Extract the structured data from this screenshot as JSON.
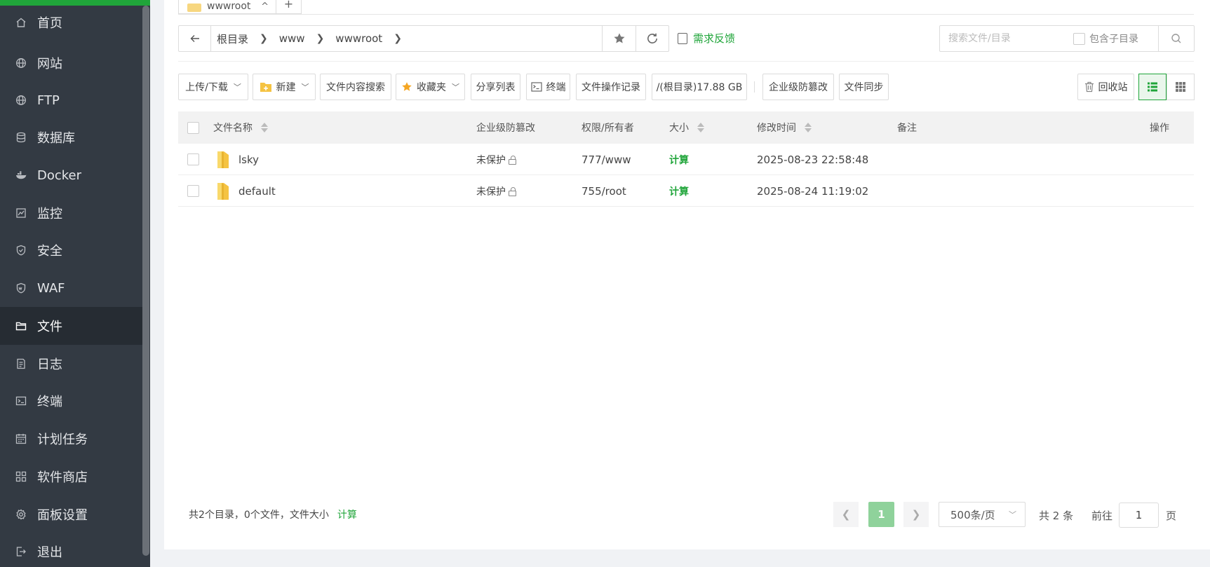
{
  "sidebar": {
    "items": [
      {
        "label": "首页",
        "icon": "home-icon"
      },
      {
        "label": "网站",
        "icon": "globe-icon"
      },
      {
        "label": "FTP",
        "icon": "ftp-globe-icon"
      },
      {
        "label": "数据库",
        "icon": "database-icon"
      },
      {
        "label": "Docker",
        "icon": "docker-icon"
      },
      {
        "label": "监控",
        "icon": "monitor-icon"
      },
      {
        "label": "安全",
        "icon": "shield-icon"
      },
      {
        "label": "WAF",
        "icon": "waf-shield-icon"
      },
      {
        "label": "文件",
        "icon": "folder-icon",
        "active": true
      },
      {
        "label": "日志",
        "icon": "log-icon"
      },
      {
        "label": "终端",
        "icon": "terminal-icon"
      },
      {
        "label": "计划任务",
        "icon": "calendar-icon"
      },
      {
        "label": "软件商店",
        "icon": "apps-icon"
      },
      {
        "label": "面板设置",
        "icon": "gear-icon"
      },
      {
        "label": "退出",
        "icon": "logout-icon"
      }
    ]
  },
  "tabs": {
    "active_label": "wwwroot",
    "close_glyph": "^",
    "add_glyph": "+"
  },
  "path": {
    "crumbs": [
      "根目录",
      "www",
      "wwwroot"
    ],
    "feedback_label": "需求反馈"
  },
  "search": {
    "placeholder": "搜索文件/目录",
    "subdir_label": "包含子目录"
  },
  "toolbar": {
    "upload_download": "上传/下载",
    "new": "新建",
    "content_search": "文件内容搜索",
    "favorites": "收藏夹",
    "share_list": "分享列表",
    "terminal": "终端",
    "op_log": "文件操作记录",
    "disk": "/(根目录)17.88 GB",
    "tamper": "企业级防篡改",
    "sync": "文件同步",
    "recycle": "回收站"
  },
  "table": {
    "headers": {
      "name": "文件名称",
      "tamper": "企业级防篡改",
      "perm": "权限/所有者",
      "size": "大小",
      "mtime": "修改时间",
      "remark": "备注",
      "ops": "操作"
    },
    "rows": [
      {
        "name": "lsky",
        "tamper": "未保护",
        "perm": "777/www",
        "size": "计算",
        "mtime": "2025-08-23 22:58:48",
        "remark": ""
      },
      {
        "name": "default",
        "tamper": "未保护",
        "perm": "755/root",
        "size": "计算",
        "mtime": "2025-08-24 11:19:02",
        "remark": ""
      }
    ]
  },
  "footer": {
    "summary": "共2个目录，0个文件，文件大小",
    "calc": "计算",
    "current_page": "1",
    "page_size": "500条/页",
    "total": "共 2 条",
    "goto_label": "前往",
    "goto_value": "1",
    "page_suffix": "页"
  },
  "colors": {
    "accent": "#20a53a",
    "sidebar_bg": "#333a43",
    "sidebar_active": "#262c33"
  }
}
